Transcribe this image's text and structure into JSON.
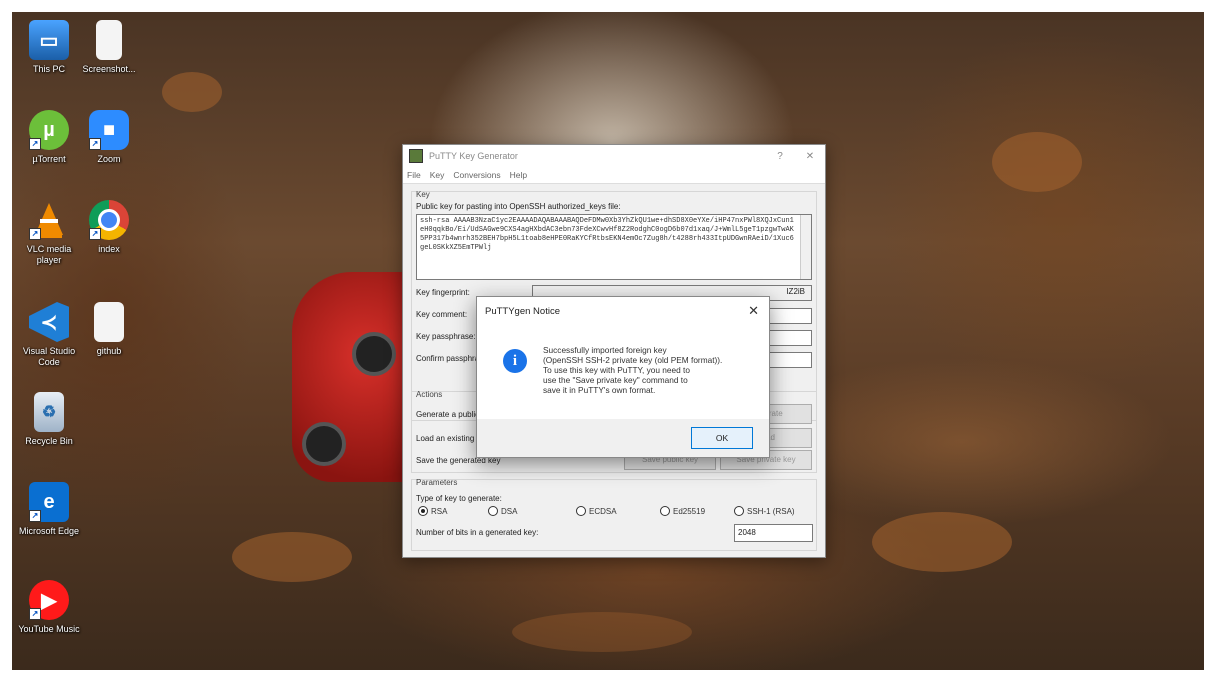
{
  "desktop": {
    "icons": [
      {
        "label": "This PC",
        "icon": "computer-icon"
      },
      {
        "label": "Screenshot...",
        "icon": "document-icon"
      },
      {
        "label": "µTorrent",
        "icon": "utorrent-icon"
      },
      {
        "label": "Zoom",
        "icon": "zoom-icon"
      },
      {
        "label": "VLC media player",
        "icon": "vlc-icon"
      },
      {
        "label": "index",
        "icon": "chrome-icon"
      },
      {
        "label": "Visual Studio Code",
        "icon": "vscode-icon"
      },
      {
        "label": "github",
        "icon": "document-icon"
      },
      {
        "label": "Recycle Bin",
        "icon": "recycle-bin-icon"
      },
      {
        "label": "Microsoft Edge",
        "icon": "edge-icon"
      },
      {
        "label": "YouTube Music",
        "icon": "youtube-music-icon"
      }
    ]
  },
  "putty": {
    "title": "PuTTY Key Generator",
    "title_controls": {
      "help": "?",
      "close": "✕"
    },
    "menu": [
      "File",
      "Key",
      "Conversions",
      "Help"
    ],
    "key_group_label": "Key",
    "public_key_label": "Public key for pasting into OpenSSH authorized_keys file:",
    "public_key_text": "ssh-rsa AAAAB3NzaC1yc2EAAAADAQABAAABAQDeFDMw0Xb3YhZkQU1we+dhSD8X0eYXe/iHP47nxPWl8XQJxCun1eH0qqkBo/Ei/UdSAGwe9CXS4agHXbdAC3ebn73FdeXCwvHf8Z2RodghC0ogD6b07d1xaq/J+WmlL5geT1pzgwTwAK5PP317b4wnrh352BEH7bpH5L1toab8eHPE0RaKYCfRtbsEKN4emOc7Zug8h/t4288rh433ItpUDGwnRAeiD/1Xuc6geL0SKkXZ5EmTPWlj",
    "fingerprint_label": "Key fingerprint:",
    "fingerprint_value": "IZ2iB",
    "comment_label": "Key comment:",
    "passphrase_label": "Key passphrase:",
    "confirm_label": "Confirm passphrase:",
    "actions_label": "Actions",
    "generate_label": "Generate a public/private key pair",
    "generate_button": "Generate",
    "load_label": "Load an existing private key file",
    "load_button": "Load",
    "save_label": "Save the generated key",
    "save_public_button": "Save public key",
    "save_private_button": "Save private key",
    "parameters_label": "Parameters",
    "type_label": "Type of key to generate:",
    "key_types": [
      {
        "label": "RSA",
        "selected": true
      },
      {
        "label": "DSA",
        "selected": false
      },
      {
        "label": "ECDSA",
        "selected": false
      },
      {
        "label": "Ed25519",
        "selected": false
      },
      {
        "label": "SSH-1 (RSA)",
        "selected": false
      }
    ],
    "bits_label": "Number of bits in a generated key:",
    "bits_value": "2048"
  },
  "notice": {
    "title": "PuTTYgen Notice",
    "close": "✕",
    "message": "Successfully imported foreign key\n(OpenSSH SSH-2 private key (old PEM format)).\nTo use this key with PuTTY, you need to\nuse the \"Save private key\" command to\nsave it in PuTTY's own format.",
    "ok_label": "OK",
    "icon": "info-icon"
  },
  "colors": {
    "accent": "#0078d7",
    "info_icon": "#1a73e8"
  }
}
